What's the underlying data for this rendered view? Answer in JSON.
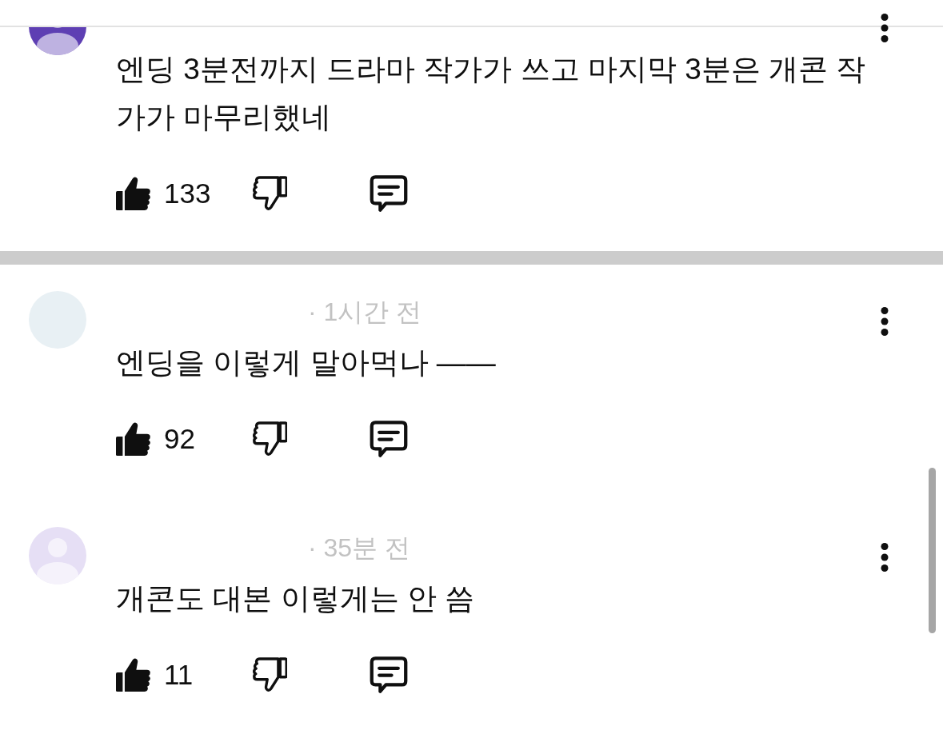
{
  "sections": [
    {
      "comments": [
        {
          "avatar": {
            "kind": "silhouette",
            "color": "#5e3fb3"
          },
          "body": "엔딩 3분전까지 드라마 작가가 쓰고 마지막 3분은 개콘 작가가 마무리했네",
          "likes": "133"
        }
      ]
    },
    {
      "comments": [
        {
          "avatar": {
            "kind": "photo",
            "color": "#e8f0f4"
          },
          "time": "· 1시간 전",
          "body": "엔딩을 이렇게 말아먹나 ——",
          "likes": "92"
        },
        {
          "avatar": {
            "kind": "silhouette",
            "color": "#e6dff5"
          },
          "time": "· 35분 전",
          "body": "개콘도 대본 이렇게는 안 씀",
          "likes": "11"
        }
      ]
    }
  ]
}
